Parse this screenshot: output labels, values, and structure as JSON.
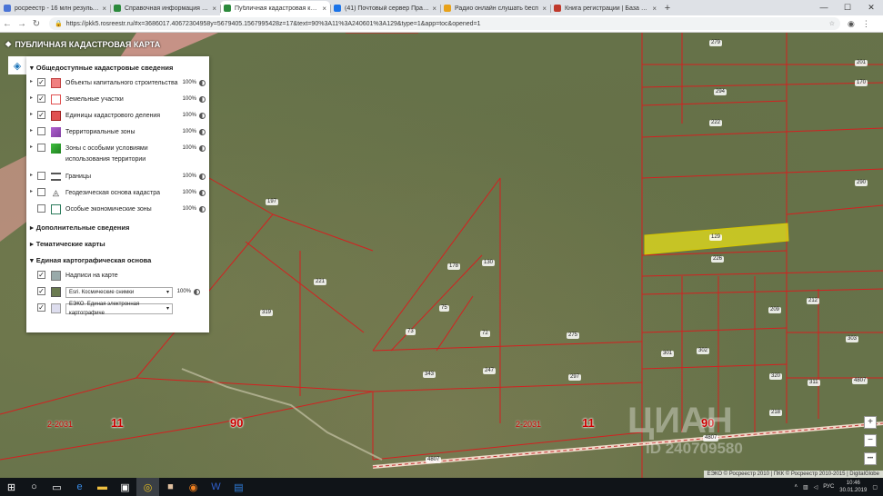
{
  "tabs": [
    {
      "title": "росреестр - 16 млн результатов",
      "fav": "#4a74d6"
    },
    {
      "title": "Справочная информация по об",
      "fav": "#2c8a3c"
    },
    {
      "title": "Публичная кадастровая карта",
      "fav": "#2c8a3c",
      "active": true
    },
    {
      "title": "(41) Почтовый сервер Правит",
      "fav": "#1a73e8"
    },
    {
      "title": "Радио онлайн слушать бесп",
      "fav": "#e8a21a"
    },
    {
      "title": "Книга регистрации | База данн",
      "fav": "#c0392b"
    }
  ],
  "address": {
    "url": "https://pkk5.rosreestr.ru/#x=3686017.40672304958y=5679405.1567995428z=17&text=90%3A11%3A240601%3A129&type=1&app=toc&opened=1"
  },
  "map": {
    "title": "ПУБЛИЧНАЯ КАДАСТРОВАЯ КАРТА",
    "attribution": "ЕЭКО © Росреестр 2010 | ПКК © Росреестр 2010-2015 | DigitalGlobe",
    "watermark": "ЦИАН",
    "watermark_id": "ID 240709580",
    "road_numbers": [
      "90",
      "90"
    ],
    "district_numbers": [
      "11",
      "11"
    ],
    "codes": [
      "2-2031",
      "2-2031"
    ],
    "selected_plot": "129",
    "labels": [
      "279",
      "201",
      "294",
      "170",
      "222",
      "290",
      "197",
      "226",
      "178",
      "130",
      "221",
      "319",
      "75",
      "73",
      "72",
      "275",
      "212",
      "209",
      "301",
      "302",
      "343",
      "247",
      "297",
      "320",
      "311",
      "303",
      "218",
      "4807",
      "4807",
      "4807"
    ],
    "zoom": {
      "in": "+",
      "out": "−",
      "more": "•••"
    }
  },
  "panel": {
    "sections": {
      "public": "Общедоступные кадастровые сведения",
      "extra": "Дополнительные сведения",
      "thematic": "Тематические карты",
      "basemap": "Единая картографическая основа"
    },
    "layers": [
      {
        "label": "Объекты капитального строительства",
        "checked": true,
        "pct": "100%",
        "color": "#f08080"
      },
      {
        "label": "Земельные участки",
        "checked": true,
        "pct": "100%",
        "color": "#ffffff"
      },
      {
        "label": "Единицы кадастрового деления",
        "checked": true,
        "pct": "100%",
        "color": "#e05050"
      },
      {
        "label": "Территориальные зоны",
        "checked": false,
        "pct": "100%",
        "color": "#b060d0"
      },
      {
        "label": "Зоны с особыми условиями использования территории",
        "checked": false,
        "pct": "100%",
        "color": "#40c040"
      },
      {
        "label": "Границы",
        "checked": false,
        "pct": "100%",
        "color": "#ffffff"
      },
      {
        "label": "Геодезическая основа кадастра",
        "checked": false,
        "pct": "100%",
        "color": "#ffffff"
      },
      {
        "label": "Особые экономические зоны",
        "checked": false,
        "pct": "100%",
        "color": "#ffffff"
      }
    ],
    "basemap": [
      {
        "label": "Надписи на карте",
        "checked": true
      },
      {
        "label": "Esri. Космические снимки",
        "checked": true,
        "pct": "100%"
      },
      {
        "label": "ЕЭКО. Единая электронная картографиче",
        "checked": true
      }
    ]
  },
  "taskbar": {
    "lang": "РУС",
    "time": "10:46",
    "date": "30.01.2019"
  }
}
